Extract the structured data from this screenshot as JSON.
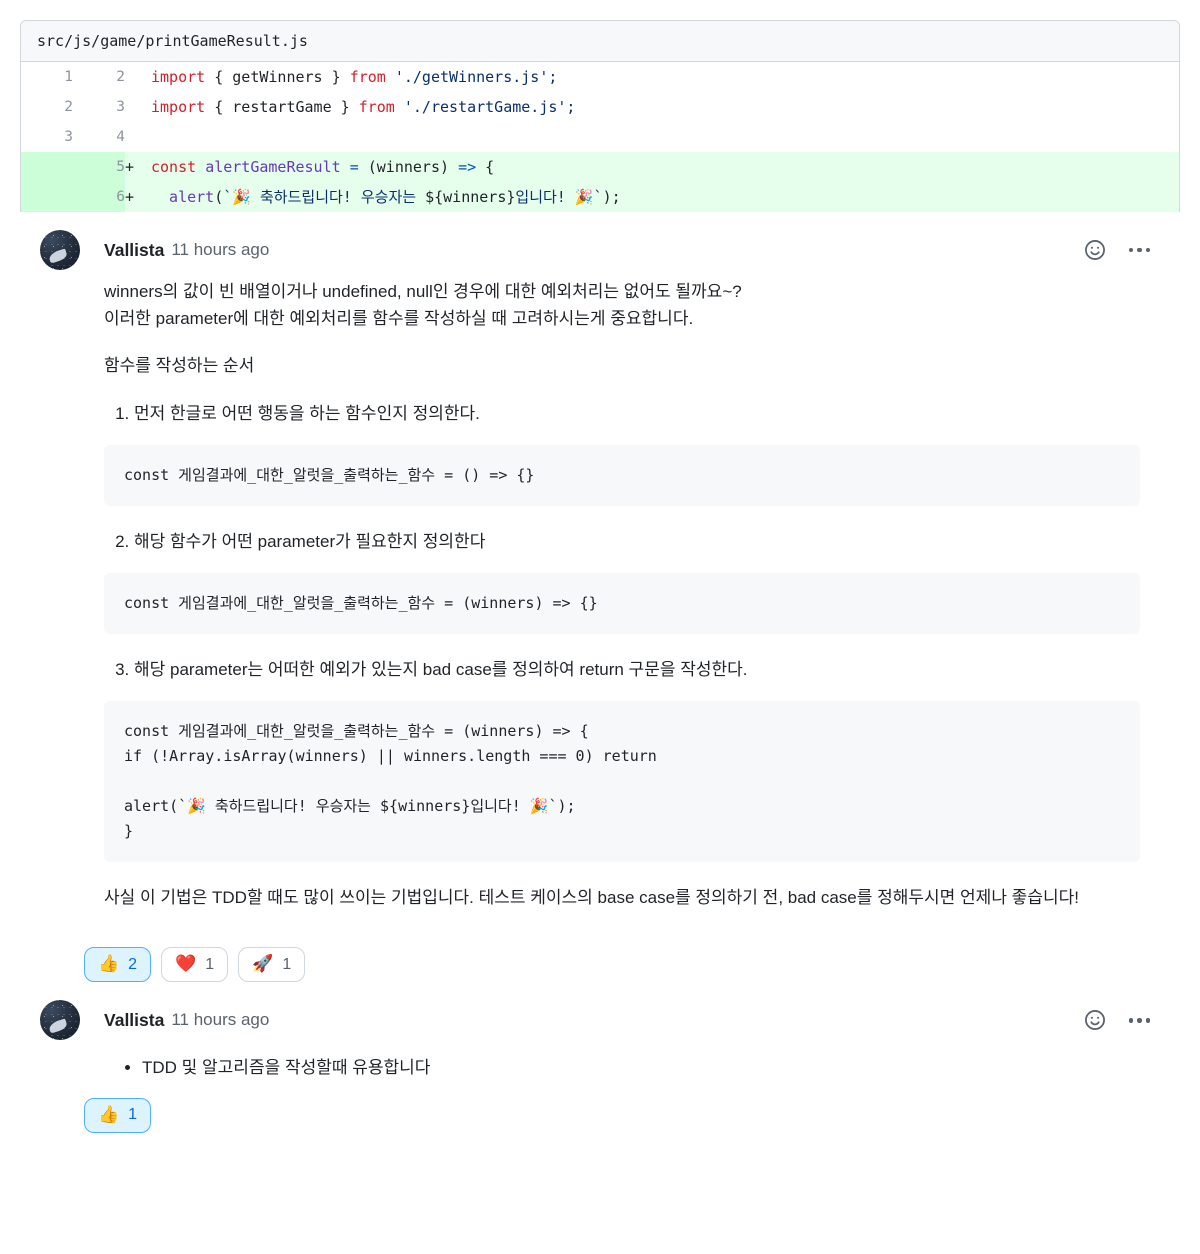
{
  "diff": {
    "file_path": "src/js/game/printGameResult.js",
    "rows": [
      {
        "old_line": "1",
        "new_line": "2",
        "marker": "",
        "type": "context",
        "tokens": [
          {
            "t": "import ",
            "c": "kw"
          },
          {
            "t": "{ getWinners } ",
            "c": "plain"
          },
          {
            "t": "from ",
            "c": "kw"
          },
          {
            "t": "'./getWinners.js';",
            "c": "str"
          }
        ]
      },
      {
        "old_line": "2",
        "new_line": "3",
        "marker": "",
        "type": "context",
        "tokens": [
          {
            "t": "import ",
            "c": "kw"
          },
          {
            "t": "{ restartGame } ",
            "c": "plain"
          },
          {
            "t": "from ",
            "c": "kw"
          },
          {
            "t": "'./restartGame.js';",
            "c": "str"
          }
        ]
      },
      {
        "old_line": "3",
        "new_line": "4",
        "marker": "",
        "type": "context",
        "tokens": [
          {
            "t": "",
            "c": "plain"
          }
        ]
      },
      {
        "old_line": "",
        "new_line": "5",
        "marker": "+",
        "type": "add",
        "tokens": [
          {
            "t": "const ",
            "c": "kw"
          },
          {
            "t": "alertGameResult ",
            "c": "fn"
          },
          {
            "t": "= ",
            "c": "op"
          },
          {
            "t": "(winners) ",
            "c": "plain"
          },
          {
            "t": "=> ",
            "c": "op"
          },
          {
            "t": "{",
            "c": "plain"
          }
        ]
      },
      {
        "old_line": "",
        "new_line": "6",
        "marker": "+",
        "type": "add",
        "tokens": [
          {
            "t": "  alert",
            "c": "fn"
          },
          {
            "t": "(",
            "c": "plain"
          },
          {
            "t": "`🎉 축하드립니다! 우승자는 ",
            "c": "str"
          },
          {
            "t": "${winners}",
            "c": "plain"
          },
          {
            "t": "입니다! 🎉`",
            "c": "str"
          },
          {
            "t": ");",
            "c": "plain"
          }
        ]
      }
    ]
  },
  "comments": [
    {
      "author": "Vallista",
      "timestamp": "11 hours ago",
      "emoji_button_icon": "smiley-icon",
      "menu_icon": "kebab-menu-icon",
      "paragraphs": [
        "winners의 값이 빈 배열이거나 undefined, null인 경우에 대한 예외처리는 없어도 될까요~?",
        "이러한 parameter에 대한 예외처리를 함수를 작성하실 때 고려하시는게 중요합니다."
      ],
      "section_title": "함수를 작성하는 순서",
      "steps": [
        {
          "text": "먼저 한글로 어떤 행동을 하는 함수인지 정의한다.",
          "code": "const 게임결과에_대한_알럿을_출력하는_함수 = () => {}"
        },
        {
          "text": "해당 함수가 어떤 parameter가 필요한지 정의한다",
          "code": "const 게임결과에_대한_알럿을_출력하는_함수 = (winners) => {}"
        },
        {
          "text": "해당 parameter는 어떠한 예외가 있는지 bad case를 정의하여 return 구문을 작성한다.",
          "code": "const 게임결과에_대한_알럿을_출력하는_함수 = (winners) => {\nif (!Array.isArray(winners) || winners.length === 0) return\n\nalert(`🎉 축하드립니다! 우승자는 ${winners}입니다! 🎉`);\n}"
        }
      ],
      "closing": "사실 이 기법은 TDD할 때도 많이 쓰이는 기법입니다. 테스트 케이스의 base case를 정의하기 전, bad case를 정해두시면 언제나 좋습니다!",
      "reactions": [
        {
          "emoji": "👍",
          "name": "thumbs-up",
          "count": "2",
          "active": true
        },
        {
          "emoji": "❤️",
          "name": "heart",
          "count": "1",
          "active": false
        },
        {
          "emoji": "🚀",
          "name": "rocket",
          "count": "1",
          "active": false
        }
      ]
    },
    {
      "author": "Vallista",
      "timestamp": "11 hours ago",
      "emoji_button_icon": "smiley-icon",
      "menu_icon": "kebab-menu-icon",
      "bullets": [
        "TDD 및 알고리즘을 작성할때 유용합니다"
      ],
      "reactions": [
        {
          "emoji": "👍",
          "name": "thumbs-up",
          "count": "1",
          "active": true
        }
      ]
    }
  ],
  "colors": {
    "border": "#d0d7de",
    "diff_add_bg": "#e6ffec",
    "diff_add_gutter": "#ccffd8",
    "code_bg": "#f6f8fa",
    "accent": "#0969da",
    "muted_text": "#59636e"
  }
}
